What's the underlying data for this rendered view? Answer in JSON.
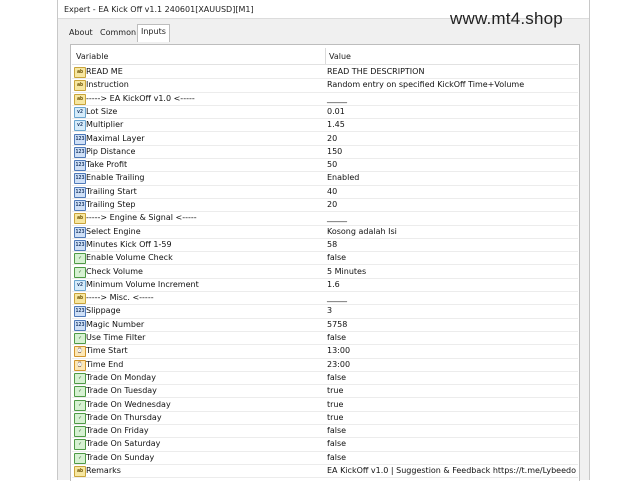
{
  "window": {
    "title": "Expert - EA Kick Off v1.1 240601[XAUUSD][M1]",
    "watermark": "www.mt4.shop"
  },
  "tabs": [
    {
      "label": "About",
      "active": false
    },
    {
      "label": "Common",
      "active": false
    },
    {
      "label": "Inputs",
      "active": true
    }
  ],
  "table": {
    "headers": {
      "variable": "Variable",
      "value": "Value"
    },
    "rows": [
      {
        "name": "READ ME",
        "value": "READ THE DESCRIPTION",
        "type": "ab"
      },
      {
        "name": "Instruction",
        "value": "Random entry on specified KickOff Time+Volume",
        "type": "ab"
      },
      {
        "name": "-----> EA KickOff v1.0 <-----",
        "value": "_____",
        "type": "ab"
      },
      {
        "name": "Lot Size",
        "value": "0.01",
        "type": "v2"
      },
      {
        "name": "Multiplier",
        "value": "1.45",
        "type": "v2"
      },
      {
        "name": "Maximal Layer",
        "value": "20",
        "type": "123"
      },
      {
        "name": "Pip Distance",
        "value": "150",
        "type": "123"
      },
      {
        "name": "Take Profit",
        "value": "50",
        "type": "123"
      },
      {
        "name": "Enable Trailing",
        "value": "Enabled",
        "type": "123"
      },
      {
        "name": "Trailing Start",
        "value": "40",
        "type": "123"
      },
      {
        "name": "Trailing Step",
        "value": "20",
        "type": "123"
      },
      {
        "name": "-----> Engine & Signal <-----",
        "value": "_____",
        "type": "ab"
      },
      {
        "name": "Select Engine",
        "value": "Kosong adalah Isi",
        "type": "123"
      },
      {
        "name": "Minutes Kick Off 1-59",
        "value": "58",
        "type": "123"
      },
      {
        "name": "Enable Volume Check",
        "value": "false",
        "type": "bool"
      },
      {
        "name": "Check Volume",
        "value": "5 Minutes",
        "type": "bool"
      },
      {
        "name": "Minimum Volume Increment",
        "value": "1.6",
        "type": "v2"
      },
      {
        "name": "-----> Misc. <-----",
        "value": "_____",
        "type": "ab"
      },
      {
        "name": "Slippage",
        "value": "3",
        "type": "123"
      },
      {
        "name": "Magic Number",
        "value": "5758",
        "type": "123"
      },
      {
        "name": "Use Time Filter",
        "value": "false",
        "type": "bool"
      },
      {
        "name": "Time Start",
        "value": "13:00",
        "type": "time"
      },
      {
        "name": "Time End",
        "value": "23:00",
        "type": "time"
      },
      {
        "name": "Trade On Monday",
        "value": "false",
        "type": "bool"
      },
      {
        "name": "Trade On Tuesday",
        "value": "true",
        "type": "bool"
      },
      {
        "name": "Trade On Wednesday",
        "value": "true",
        "type": "bool"
      },
      {
        "name": "Trade On Thursday",
        "value": "true",
        "type": "bool"
      },
      {
        "name": "Trade On Friday",
        "value": "false",
        "type": "bool"
      },
      {
        "name": "Trade On Saturday",
        "value": "false",
        "type": "bool"
      },
      {
        "name": "Trade On Sunday",
        "value": "false",
        "type": "bool"
      },
      {
        "name": "Remarks",
        "value": "EA KickOff v1.0 | Suggestion & Feedback https://t.me/Lybeedo",
        "type": "ab"
      }
    ]
  },
  "icons": {
    "ab": "string-type-icon",
    "123": "integer-type-icon",
    "v2": "double-type-icon",
    "bool": "boolean-type-icon",
    "time": "datetime-type-icon"
  }
}
